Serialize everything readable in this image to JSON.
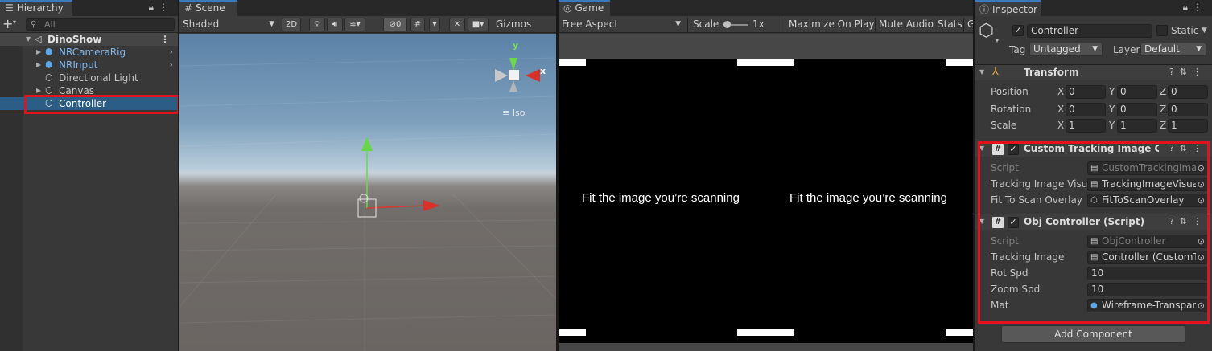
{
  "hierarchy": {
    "tab": "Hierarchy",
    "search_placeholder": "All",
    "scene": "DinoShow",
    "items": [
      {
        "label": "NRCameraRig",
        "prefab": true
      },
      {
        "label": "NRInput",
        "prefab": true
      },
      {
        "label": "Directional Light",
        "prefab": false
      },
      {
        "label": "Canvas",
        "prefab": false
      },
      {
        "label": "Controller",
        "prefab": false,
        "selected": true
      }
    ]
  },
  "scene": {
    "tab": "Scene",
    "shading": "Shaded",
    "btn_2d": "2D",
    "hidden_count": "0",
    "gizmos": "Gizmos",
    "axis_x": "x",
    "axis_y": "y",
    "iso": "Iso"
  },
  "game": {
    "tab": "Game",
    "aspect": "Free Aspect",
    "scale_label": "Scale",
    "scale_value": "1x",
    "maximize": "Maximize On Play",
    "mute": "Mute Audio",
    "stats": "Stats",
    "gizmos_cut": "G",
    "overlay_text_left": "Fit the image you’re scanning",
    "overlay_text_right": "Fit the image you’re scanning"
  },
  "inspector": {
    "tab": "Inspector",
    "object_name": "Controller",
    "static_label": "Static",
    "tag_label": "Tag",
    "tag_value": "Untagged",
    "layer_label": "Layer",
    "layer_value": "Default",
    "transform": {
      "title": "Transform",
      "rows": [
        {
          "label": "Position",
          "x": "0",
          "y": "0",
          "z": "0"
        },
        {
          "label": "Rotation",
          "x": "0",
          "y": "0",
          "z": "0"
        },
        {
          "label": "Scale",
          "x": "1",
          "y": "1",
          "z": "1"
        }
      ]
    },
    "custom_tracking": {
      "title": "Custom Tracking Image Con",
      "script_label": "Script",
      "script_value": "CustomTrackingIma",
      "visualizer_label": "Tracking Image Visua",
      "visualizer_value": "TrackingImageVisua",
      "fit_label": "Fit To Scan Overlay",
      "fit_value": "FitToScanOverlay"
    },
    "obj_controller": {
      "title": "Obj Controller (Script)",
      "script_label": "Script",
      "script_value": "ObjController",
      "tracking_label": "Tracking Image",
      "tracking_value": "Controller (CustomT",
      "rot_label": "Rot Spd",
      "rot_value": "10",
      "zoom_label": "Zoom Spd",
      "zoom_value": "10",
      "mat_label": "Mat",
      "mat_value": "Wireframe-Transpar"
    },
    "add_component": "Add Component"
  }
}
